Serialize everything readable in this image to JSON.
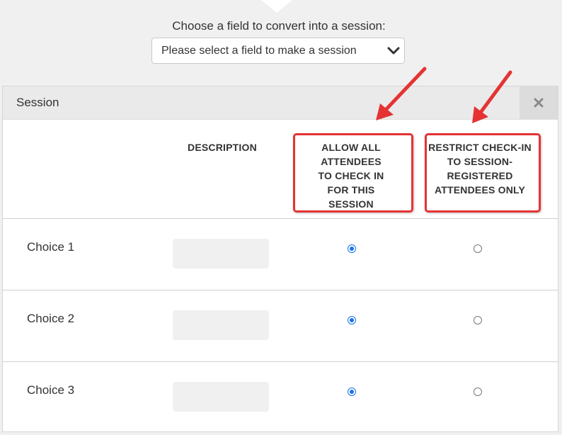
{
  "field_select": {
    "label": "Choose a field to convert into a session:",
    "selected": "Please select a field to make a session"
  },
  "panel": {
    "title": "Session",
    "close_icon": "close-icon",
    "columns": {
      "description": "DESCRIPTION",
      "allow_all": "ALLOW ALL ATTENDEES TO CHECK IN FOR THIS SESSION",
      "restrict": "RESTRICT CHECK-IN TO SESSION-REGISTERED ATTENDEES ONLY"
    },
    "rows": [
      {
        "label": "Choice 1",
        "allow_all": true,
        "restrict": false
      },
      {
        "label": "Choice 2",
        "allow_all": true,
        "restrict": false
      },
      {
        "label": "Choice 3",
        "allow_all": true,
        "restrict": false
      }
    ]
  },
  "colors": {
    "annotation": "#e53333",
    "radio_selected": "#1a73e8"
  }
}
